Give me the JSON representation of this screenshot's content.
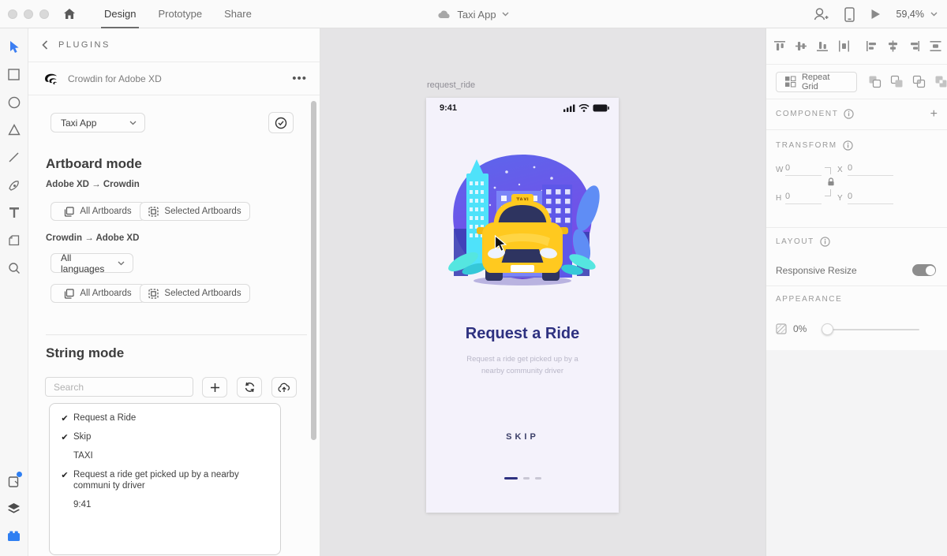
{
  "topbar": {
    "tabs": [
      {
        "label": "Design"
      },
      {
        "label": "Prototype"
      },
      {
        "label": "Share"
      }
    ],
    "document_title": "Taxi App",
    "zoom_level": "59,4%"
  },
  "plugins_panel": {
    "header": "PLUGINS",
    "plugin_name": "Crowdin for Adobe XD",
    "project_select": "Taxi App",
    "artboard_mode": {
      "title": "Artboard mode",
      "xd_to_crowdin": "Adobe XD → Crowdin",
      "crowdin_to_xd": "Crowdin → Adobe XD",
      "all_artboards": "All Artboards",
      "selected_artboards": "Selected Artboards",
      "languages_select": "All languages"
    },
    "string_mode": {
      "title": "String mode",
      "search_placeholder": "Search",
      "strings": [
        {
          "mark": "✔",
          "text": "Request a Ride"
        },
        {
          "mark": "✔",
          "text": "Skip"
        },
        {
          "mark": "",
          "text": "TAXI"
        },
        {
          "mark": "✔",
          "text": "Request a ride get picked up by a nearby communi ty driver"
        },
        {
          "mark": "",
          "text": "9:41"
        }
      ]
    }
  },
  "canvas": {
    "artboard_name": "request_ride",
    "phone": {
      "status_time": "9:41",
      "taxi_sign": "TAXI",
      "title": "Request a Ride",
      "subtitle_line1": "Request a ride get picked up by a",
      "subtitle_line2": "nearby community driver",
      "skip": "SKIP"
    }
  },
  "right_panel": {
    "repeat_grid": "Repeat Grid",
    "component": {
      "title": "COMPONENT",
      "add": "+"
    },
    "transform": {
      "title": "TRANSFORM",
      "w_label": "W",
      "w": "0",
      "x_label": "X",
      "x": "0",
      "h_label": "H",
      "h": "0",
      "y_label": "Y",
      "y": "0"
    },
    "layout": {
      "title": "LAYOUT",
      "responsive_resize": "Responsive Resize"
    },
    "appearance": {
      "title": "APPEARANCE",
      "opacity": "0%"
    }
  },
  "colors": {
    "accent_blue": "#2f7ff2",
    "heading_indigo": "#2e3180",
    "taxi_yellow": "#ffc91f",
    "canvas_gray": "#e5e4e6"
  }
}
